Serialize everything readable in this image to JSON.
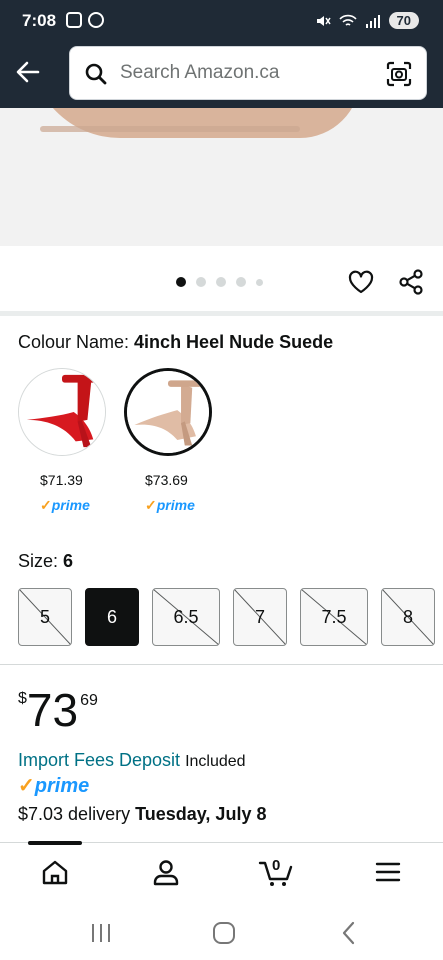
{
  "status_bar": {
    "time": "7:08",
    "battery": "70"
  },
  "search": {
    "placeholder": "Search Amazon.ca"
  },
  "carousel": {
    "dot_count": 5,
    "active_index": 0
  },
  "colour": {
    "label": "Colour Name: ",
    "value": "4inch Heel Nude Suede",
    "swatches": [
      {
        "name": "red",
        "price": "$71.39",
        "prime": "prime",
        "color": "#d71920",
        "selected": false
      },
      {
        "name": "nude",
        "price": "$73.69",
        "prime": "prime",
        "color": "#d9b49c",
        "selected": true
      }
    ]
  },
  "size": {
    "label": "Size: ",
    "value": "6",
    "options": [
      {
        "label": "5",
        "available": false,
        "selected": false
      },
      {
        "label": "6",
        "available": true,
        "selected": true
      },
      {
        "label": "6.5",
        "available": false,
        "selected": false
      },
      {
        "label": "7",
        "available": false,
        "selected": false
      },
      {
        "label": "7.5",
        "available": false,
        "selected": false
      },
      {
        "label": "8",
        "available": false,
        "selected": false
      }
    ]
  },
  "price": {
    "currency": "$",
    "whole": "73",
    "fraction": "69"
  },
  "import_fees": {
    "link": "Import Fees Deposit",
    "status": "Included"
  },
  "prime_badge": "prime",
  "delivery": {
    "text": "$7.03 delivery ",
    "date": "Tuesday, July 8"
  },
  "bottom_nav": {
    "cart_count": "0",
    "items": [
      "home-icon",
      "account-icon",
      "cart-icon",
      "menu-icon"
    ]
  },
  "colors": {
    "header_bg": "#1f2a36",
    "link": "#007185",
    "prime_blue": "#1a98ff",
    "prime_orange": "#f8a11f"
  }
}
